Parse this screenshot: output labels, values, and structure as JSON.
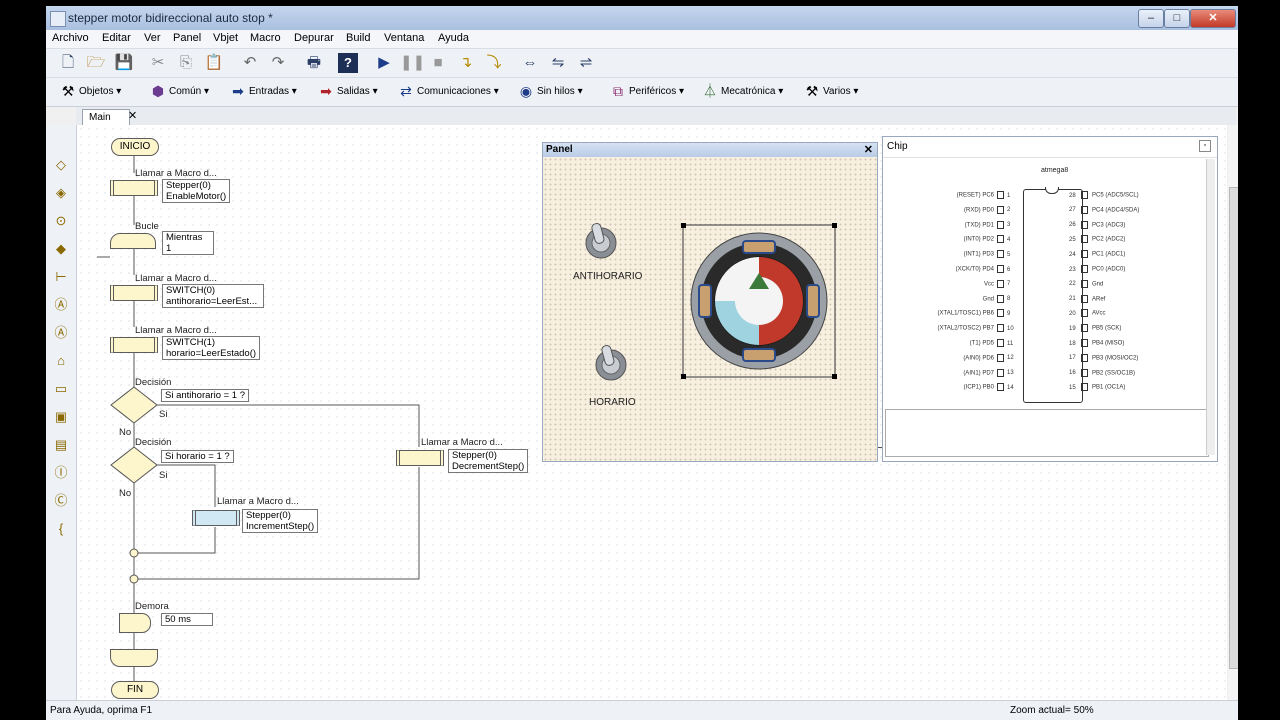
{
  "window": {
    "title": "stepper motor bidireccional auto stop *"
  },
  "menu": [
    "Archivo",
    "Editar",
    "Ver",
    "Panel",
    "Vbjet",
    "Macro",
    "Depurar",
    "Build",
    "Ventana",
    "Ayuda"
  ],
  "toolbar2": [
    "Objetos",
    "Común",
    "Entradas",
    "Salidas",
    "Comunicaciones",
    "Sin hilos",
    "Periféricos",
    "Mecatrónica",
    "Varios"
  ],
  "tabs": {
    "main": "Main"
  },
  "flow": {
    "start": "INICIO",
    "end": "FIN",
    "macro1_label": "Llamar a Macro d...",
    "macro1_l1": "Stepper(0)",
    "macro1_l2": "EnableMotor()",
    "loop_label": "Bucle",
    "loop_l1": "Mientras",
    "loop_l2": "1",
    "macro2_label": "Llamar a Macro d...",
    "macro2_l1": "SWITCH(0)",
    "macro2_l2": "antihorario=LeerEst...",
    "macro3_label": "Llamar a Macro d...",
    "macro3_l1": "SWITCH(1)",
    "macro3_l2": "horario=LeerEstado()",
    "dec1_label": "Decisión",
    "dec1_cond": "Si  antihorario = 1 ?",
    "dec1_yes": "Si",
    "dec1_no": "No",
    "dec2_label": "Decisión",
    "dec2_cond": "Si  horario = 1 ?",
    "dec2_yes": "Si",
    "dec2_no": "No",
    "macro4_label": "Llamar a Macro d...",
    "macro4_l1": "Stepper(0)",
    "macro4_l2": "DecrementStep()",
    "macro5_label": "Llamar a Macro d...",
    "macro5_l1": "Stepper(0)",
    "macro5_l2": "IncrementStep()",
    "delay_label": "Demora",
    "delay_value": "50 ms"
  },
  "panel": {
    "title": "Panel",
    "switch1": "ANTIHORARIO",
    "switch2": "HORARIO"
  },
  "chip": {
    "title": "Chip",
    "name": "atmega8",
    "left_pins": [
      {
        "label": "(RESET) PC6",
        "num": "1"
      },
      {
        "label": "(RXD) PD0",
        "num": "2"
      },
      {
        "label": "(TXD) PD1",
        "num": "3"
      },
      {
        "label": "(INT0) PD2",
        "num": "4"
      },
      {
        "label": "(INT1) PD3",
        "num": "5"
      },
      {
        "label": "(XCK/T0) PD4",
        "num": "6"
      },
      {
        "label": "Vcc",
        "num": "7"
      },
      {
        "label": "Gnd",
        "num": "8"
      },
      {
        "label": "(XTAL1/TOSC1) PB6",
        "num": "9"
      },
      {
        "label": "(XTAL2/TOSC2) PB7",
        "num": "10"
      },
      {
        "label": "(T1) PD5",
        "num": "11"
      },
      {
        "label": "(AIN0) PD6",
        "num": "12"
      },
      {
        "label": "(AIN1) PD7",
        "num": "13"
      },
      {
        "label": "(ICP1) PB0",
        "num": "14"
      }
    ],
    "right_pins": [
      {
        "label": "PC5 (ADC5/SCL)",
        "num": "28"
      },
      {
        "label": "PC4 (ADC4/SDA)",
        "num": "27"
      },
      {
        "label": "PC3 (ADC3)",
        "num": "26"
      },
      {
        "label": "PC2 (ADC2)",
        "num": "25"
      },
      {
        "label": "PC1 (ADC1)",
        "num": "24"
      },
      {
        "label": "PC0 (ADC0)",
        "num": "23"
      },
      {
        "label": "Gnd",
        "num": "22"
      },
      {
        "label": "ARef",
        "num": "21"
      },
      {
        "label": "AVcc",
        "num": "20"
      },
      {
        "label": "PB5 (SCK)",
        "num": "19"
      },
      {
        "label": "PB4 (MISO)",
        "num": "18"
      },
      {
        "label": "PB3 (MOSI/OC2)",
        "num": "17"
      },
      {
        "label": "PB2 (SS/OC1B)",
        "num": "16"
      },
      {
        "label": "PB1 (OC1A)",
        "num": "15"
      }
    ]
  },
  "status": {
    "help": "Para Ayuda, oprima F1",
    "zoom": "Zoom actual= 50%"
  }
}
